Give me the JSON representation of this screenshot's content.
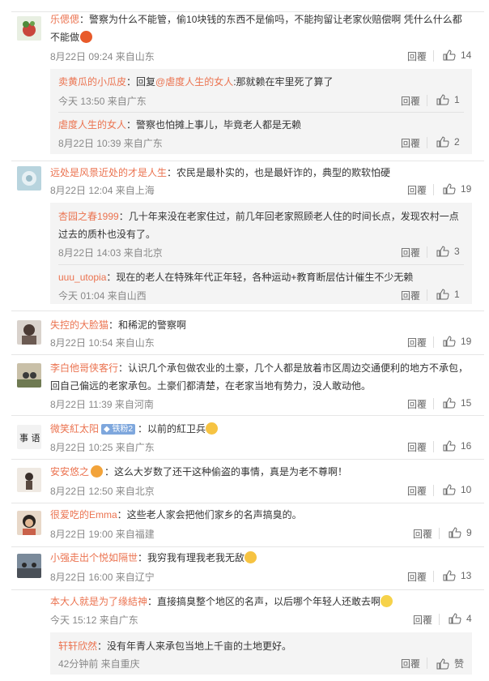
{
  "comments": [
    {
      "user": "乐偲偲",
      "text1": "：警察为什么不能管，偷10块钱的东西不是偷吗，不能拘留让老家伙赔偿啊 凭什么什么都",
      "text2": "不能做",
      "time": "8月22日 09:24 来自山东",
      "likes": "14"
    },
    {
      "user": "卖黄瓜的小瓜皮",
      "text1": "：回复",
      "mention": "@虐度人生的女人",
      "text1b": ":那就赖在牢里死了算了",
      "time": "今天 13:50 来自广东",
      "likes": "1"
    },
    {
      "user": "虐度人生的女人",
      "text1": "：警察也怕摊上事儿，毕竟老人都是无赖",
      "time": "8月22日 10:39 来自广东",
      "likes": "2"
    },
    {
      "user": "远处是风景近处的才是人生",
      "text1": "：农民是最朴实的，也是最奸诈的，典型的欺软怕硬",
      "time": "8月22日 12:04 来自上海",
      "likes": "19"
    },
    {
      "user": "杏园之春1999",
      "text1": "：几十年来没在老家住过，前几年回老家照顾老人住的时间长点，发现农村一点",
      "text2": "过去的质朴也没有了。",
      "time": "8月22日 14:03 来自北京",
      "likes": "3"
    },
    {
      "user": "uuu_utopia",
      "text1": "：现在的老人在特殊年代正年轻，各种运动+教育断层估计催生不少无赖",
      "time": "今天 01:04 来自山西",
      "likes": "1"
    },
    {
      "user": "失控的大脸猫",
      "text1": "：和稀泥的警察啊",
      "time": "8月22日 10:54 来自山东",
      "likes": "19"
    },
    {
      "user": "李白他哥侠客行",
      "text1": "：认识几个承包做农业的土豪，几个人都是放着市区周边交通便利的地方不承包，",
      "text2": "回自己偏远的老家承包。土豪们都清楚，在老家当地有势力，没人敢动他。",
      "time": "8月22日 11:39 来自河南",
      "likes": "15"
    },
    {
      "user": "微笑紅太阳",
      "badge": "◆ 铁粉2",
      "text1": "：以前的紅卫兵",
      "time": "8月22日 10:25 来自广东",
      "likes": "16"
    },
    {
      "user": "安安悠之",
      "text1": "：这么大岁数了还干这种偷盗的事情，真是为老不尊啊！",
      "time": "8月22日 12:50 来自北京",
      "likes": "10"
    },
    {
      "user": "很爱吃的Emma",
      "text1": "：这些老人家会把他们家乡的名声搞臭的。",
      "time": "8月22日 19:00 来自福建",
      "likes": "9"
    },
    {
      "user": "小强走出个悦如隔世",
      "text1": "：我穷我有理我老我无敌",
      "time": "8月22日 16:00 来自辽宁",
      "likes": "13"
    },
    {
      "user": "本大人就是为了缘結神",
      "text1": "：直接搞臭整个地区的名声，以后哪个年轻人还敢去啊",
      "time": "今天 15:12 来自广东",
      "likes": "4"
    },
    {
      "user": "轩轩欣然",
      "text1": "：没有年青人来承包当地上千亩的土地更好。",
      "time": "42分钟前 来自重庆",
      "likes": "赞"
    }
  ],
  "reply_label": "回覆",
  "colors": {
    "username": "#eb7350",
    "mention": "#eb7350",
    "meta": "#888888"
  }
}
